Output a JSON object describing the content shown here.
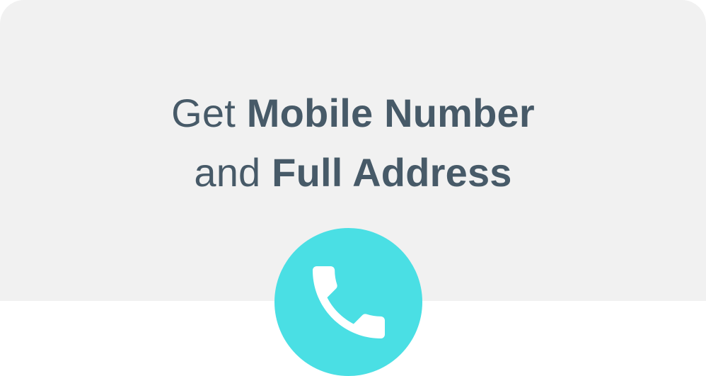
{
  "headline": {
    "line1_light": "Get",
    "line1_bold": "Mobile Number",
    "line2_light": "and",
    "line2_bold": "Full Address"
  },
  "call_button": {
    "icon": "phone-icon",
    "color": "#4adfe4"
  },
  "colors": {
    "card_background": "#f1f1f1",
    "text": "#475a68",
    "icon": "#ffffff"
  }
}
